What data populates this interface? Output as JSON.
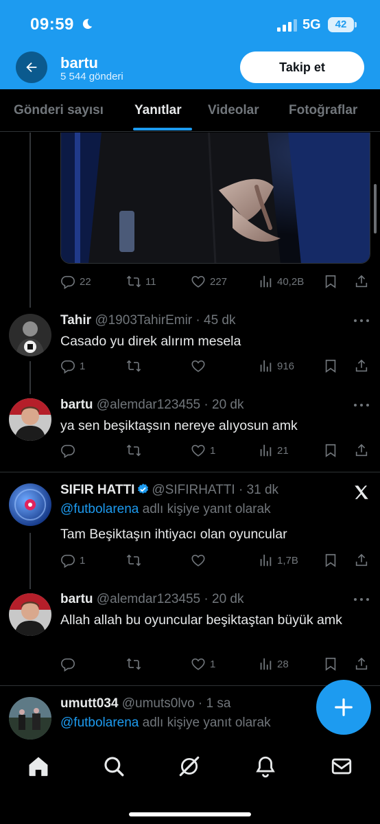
{
  "status_bar": {
    "time": "09:59",
    "network": "5G",
    "battery": "42"
  },
  "header": {
    "title": "bartu",
    "subtitle": "5 544 gönderi",
    "follow_label": "Takip et"
  },
  "tabs": [
    {
      "label": "Gönderi sayısı"
    },
    {
      "label": "Yanıtlar",
      "active": true
    },
    {
      "label": "Videolar"
    },
    {
      "label": "Fotoğraflar"
    }
  ],
  "top_post_actions": {
    "replies": "22",
    "reposts": "11",
    "likes": "227",
    "views": "40,2B"
  },
  "posts": [
    {
      "name": "Tahir",
      "meta": "@1903TahirEmir · 45 dk",
      "text": "Casado yu direk alırım mesela",
      "actions": {
        "replies": "1",
        "reposts": "",
        "likes": "",
        "views": "916"
      }
    },
    {
      "name": "bartu",
      "meta": "@alemdar123455 · 20 dk",
      "text": "ya sen beşiktaşsın nereye alıyosun amk",
      "actions": {
        "replies": "",
        "reposts": "",
        "likes": "1",
        "views": "21"
      }
    },
    {
      "name": "SIFIR HATTI",
      "meta": "@SIFIRHATTI · 31 dk",
      "reply_to_handle": "@futbolarena",
      "reply_to_suffix": " adlı kişiye yanıt olarak",
      "text": "Tam Beşiktaşın ihtiyacı olan oyuncular",
      "actions": {
        "replies": "1",
        "reposts": "",
        "likes": "",
        "views": "1,7B"
      }
    },
    {
      "name": "bartu",
      "meta": "@alemdar123455 · 20 dk",
      "text": "Allah allah bu oyuncular beşiktaştan büyük amk",
      "actions": {
        "replies": "",
        "reposts": "",
        "likes": "1",
        "views": "28"
      }
    },
    {
      "name": "umutt034",
      "meta": "@umuts0lvo · 1 sa",
      "reply_to_handle": "@futbolarena",
      "reply_to_suffix": " adlı kişiye yanıt olarak"
    }
  ],
  "colors": {
    "accent": "#1d9bf0",
    "background": "#000000",
    "muted": "#71767b",
    "text": "#e7e9ea"
  },
  "icons": [
    "back-arrow-icon",
    "reply-icon",
    "repost-icon",
    "like-icon",
    "views-icon",
    "bookmark-icon",
    "share-icon",
    "more-icon",
    "verified-icon",
    "x-logo-icon",
    "compose-plus-icon",
    "home-icon",
    "search-icon",
    "grok-icon",
    "bell-icon",
    "mail-icon"
  ]
}
